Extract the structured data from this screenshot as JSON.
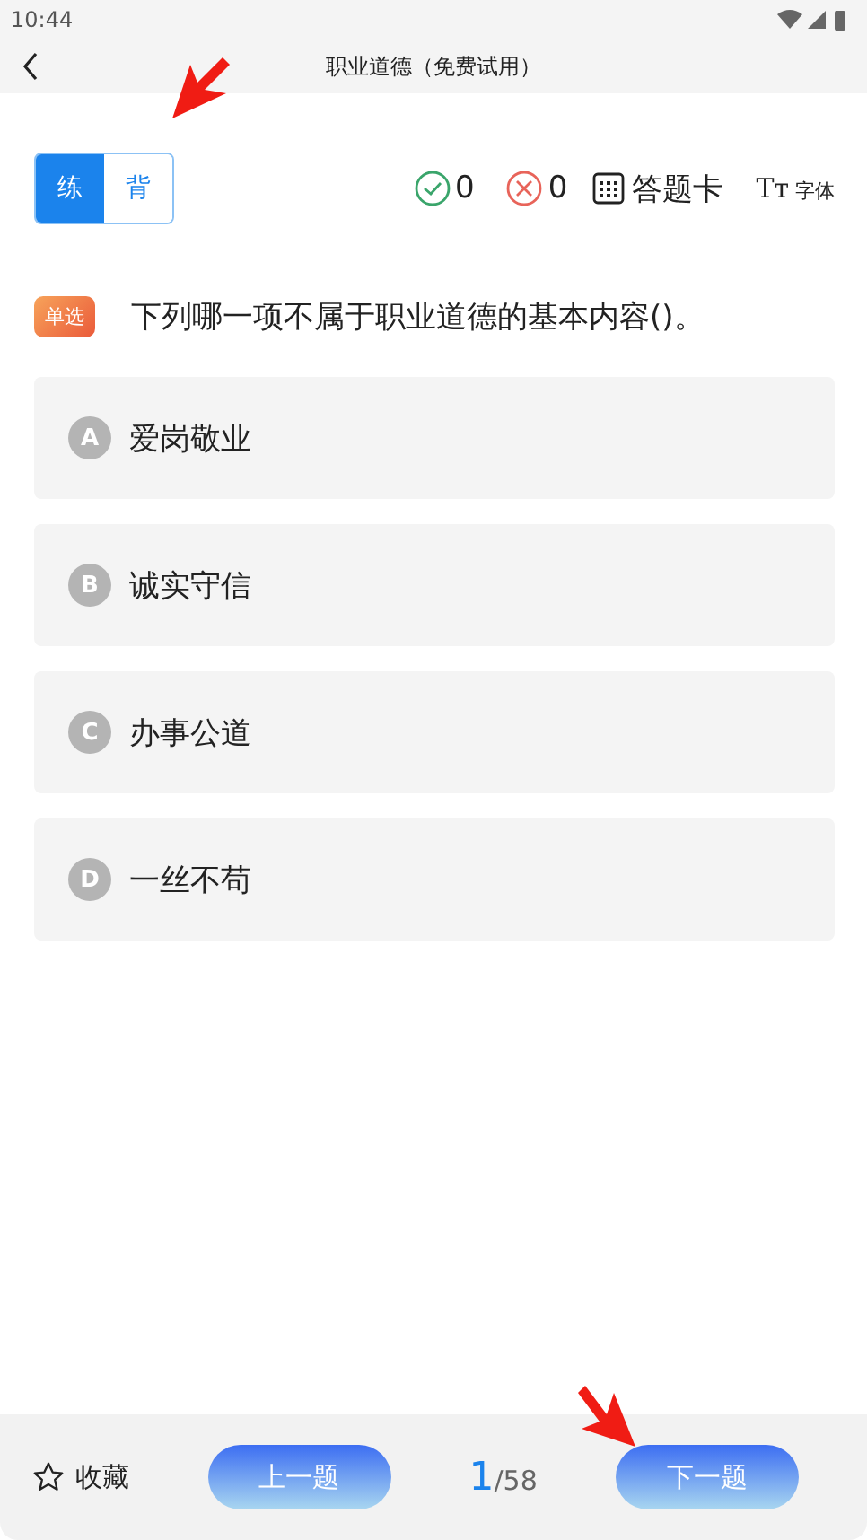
{
  "status_bar": {
    "time": "10:44"
  },
  "header": {
    "title": "职业道德（免费试用）"
  },
  "mode_tabs": [
    {
      "label": "练",
      "selected": true
    },
    {
      "label": "背",
      "selected": false
    }
  ],
  "toolbar": {
    "correct_count": "0",
    "wrong_count": "0",
    "answer_card": "答题卡",
    "font_glyph": "Tт",
    "font_label": "字体"
  },
  "question": {
    "type": "单选",
    "text": "下列哪一项不属于职业道德的基本内容()。"
  },
  "options": [
    {
      "letter": "A",
      "text": "爱岗敬业"
    },
    {
      "letter": "B",
      "text": "诚实守信"
    },
    {
      "letter": "C",
      "text": "办事公道"
    },
    {
      "letter": "D",
      "text": "一丝不苟"
    }
  ],
  "bottom_bar": {
    "favorite": "收藏",
    "prev": "上一题",
    "current": "1",
    "total": "/58",
    "next": "下一题"
  }
}
